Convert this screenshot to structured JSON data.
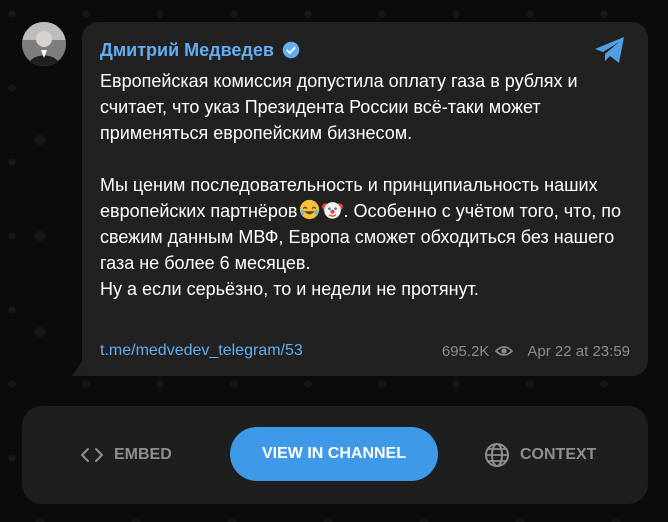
{
  "post": {
    "author": "Дмитрий Медведев",
    "paragraph1": "Европейская комиссия допустила оплату газа в рублях и считает, что указ Президента России всё-таки может применяться европейским бизнесом.",
    "paragraph2_part1": "Мы ценим последовательность и принципиальность наших европейских партнёров",
    "paragraph2_emojis": [
      "😂",
      "🤡"
    ],
    "paragraph2_part2": ". Особенно с учётом того, что, по свежим данным МВФ, Европа сможет обходиться без нашего газа не более 6 месяцев.",
    "paragraph3": "Ну а если серьёзно, то и недели не протянут.",
    "link": "t.me/medvedev_telegram/53",
    "views": "695.2K",
    "date": "Apr 22 at 23:59"
  },
  "actions": {
    "embed_label": "EMBED",
    "view_label": "VIEW IN CHANNEL",
    "context_label": "CONTEXT"
  },
  "colors": {
    "accent": "#3e9ae8",
    "author": "#62aef0",
    "bubble": "#212121",
    "background": "#0b0b0b"
  },
  "icons": [
    "verified-icon",
    "telegram-icon",
    "eye-icon",
    "code-icon",
    "globe-icon"
  ]
}
